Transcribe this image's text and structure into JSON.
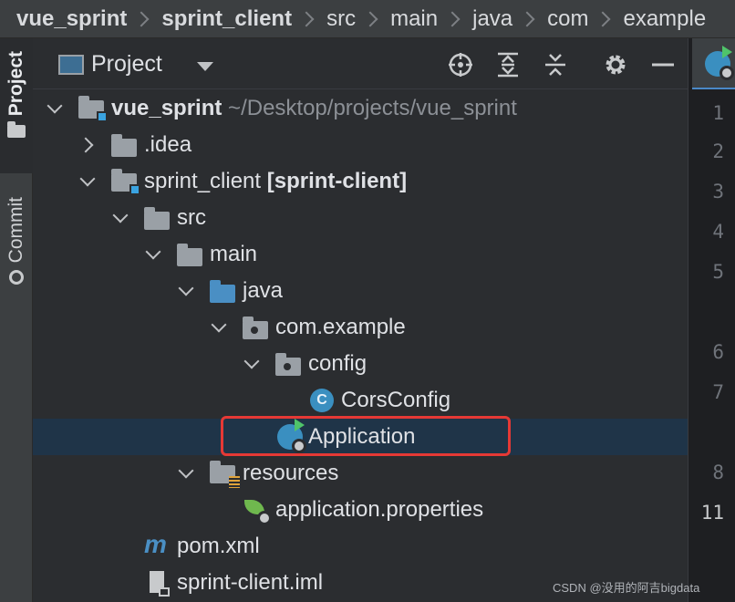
{
  "breadcrumb": [
    "vue_sprint",
    "sprint_client",
    "src",
    "main",
    "java",
    "com",
    "example"
  ],
  "toolstrip": {
    "project_label": "Project",
    "commit_label": "Commit"
  },
  "panel": {
    "title": "Project"
  },
  "tree": {
    "root_name": "vue_sprint",
    "root_path": "~/Desktop/projects/vue_sprint",
    "idea": ".idea",
    "module_name": "sprint_client",
    "module_tag": "[sprint-client]",
    "src": "src",
    "main": "main",
    "java": "java",
    "package": "com.example",
    "config": "config",
    "cors_config": "CorsConfig",
    "application": "Application",
    "resources": "resources",
    "properties": "application.properties",
    "pom": "pom.xml",
    "iml": "sprint-client.iml"
  },
  "icons": {
    "class_letter": "C",
    "maven_letter": "m"
  },
  "gutter": [
    "1",
    "2",
    "3",
    "4",
    "5",
    "6",
    "7",
    "8",
    "11"
  ],
  "watermark": "CSDN @没用的阿吉bigdata",
  "colors": {
    "selection": "#1f3448",
    "highlight_border": "#e53935",
    "folder_blue": "#4a8fc4",
    "spring_green": "#6fb84e"
  }
}
